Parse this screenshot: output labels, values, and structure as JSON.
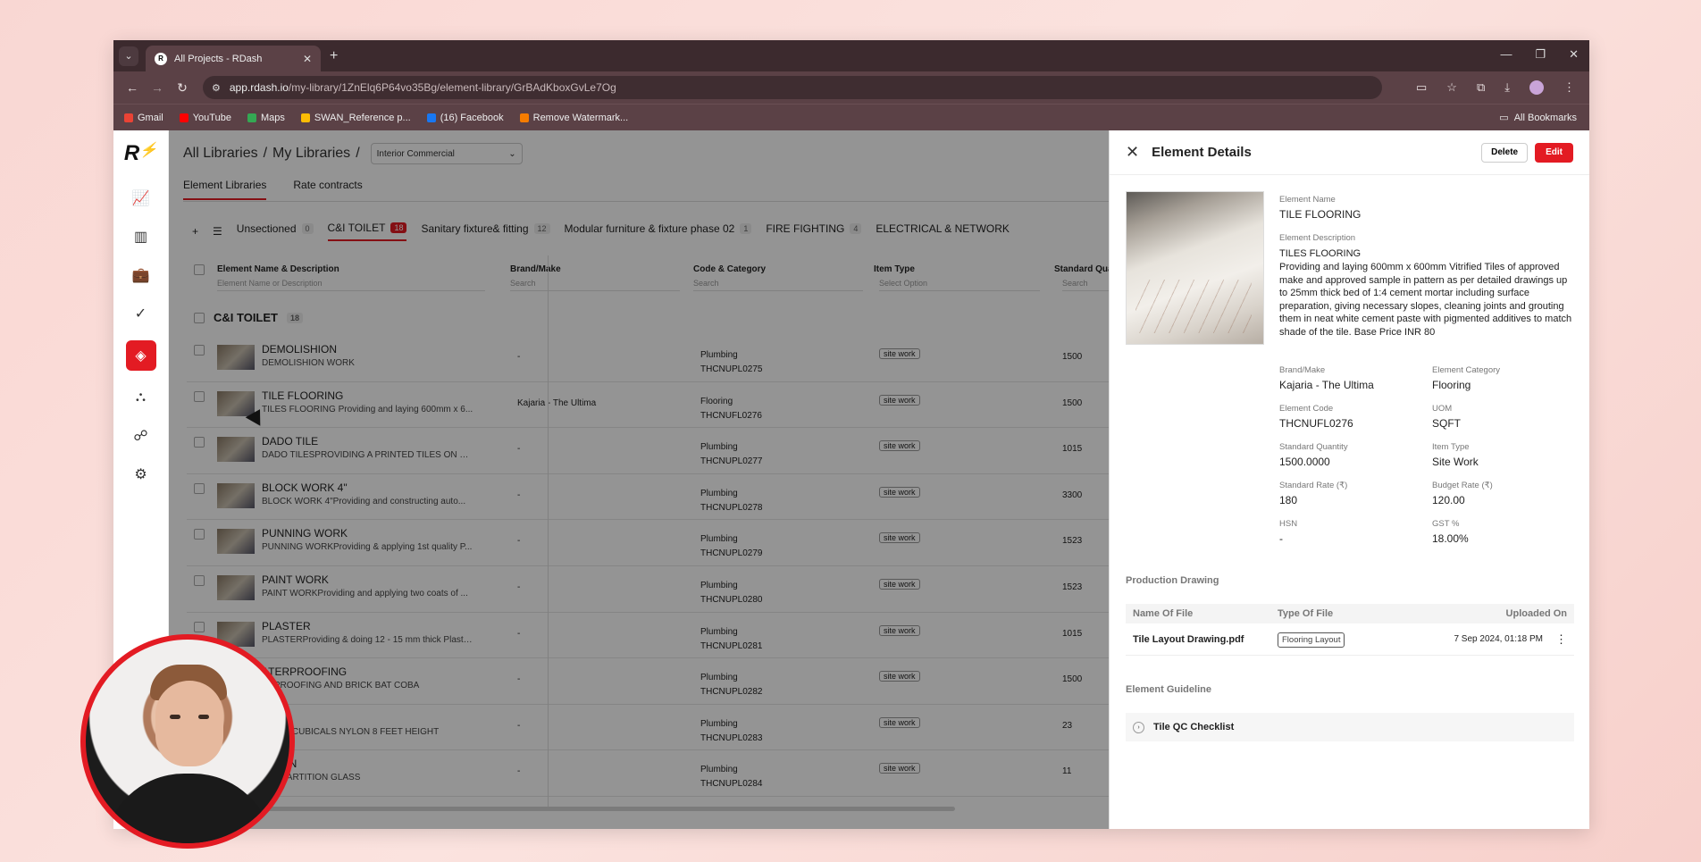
{
  "browser": {
    "tab_title": "All Projects - RDash",
    "url_domain": "app.rdash.io",
    "url_path": "/my-library/1ZnElq6P64vo35Bg/element-library/GrBAdKboxGvLe7Og",
    "bookmarks": [
      "Gmail",
      "YouTube",
      "Maps",
      "SWAN_Reference p...",
      "(16) Facebook",
      "Remove Watermark..."
    ],
    "all_bookmarks": "All Bookmarks"
  },
  "breadcrumb": {
    "all_libraries": "All Libraries",
    "sep1": "/",
    "my_libraries": "My Libraries",
    "sep2": "/",
    "library_select": "Interior Commercial"
  },
  "subtabs": [
    "Element Libraries",
    "Rate contracts"
  ],
  "category_tabs": [
    {
      "label": "Unsectioned",
      "count": "0"
    },
    {
      "label": "C&I TOILET",
      "count": "18"
    },
    {
      "label": "Sanitary fixture& fitting",
      "count": "12"
    },
    {
      "label": "Modular furniture & fixture phase 02",
      "count": "1"
    },
    {
      "label": "FIRE FIGHTING",
      "count": "4"
    },
    {
      "label": "ELECTRICAL & NETWORK",
      "count": ""
    }
  ],
  "table": {
    "headers": {
      "name": "Element Name & Description",
      "brand": "Brand/Make",
      "code": "Code & Category",
      "item_type": "Item Type",
      "qty": "Standard Quant"
    },
    "search_placeholders": {
      "name": "Element Name or Description",
      "brand": "Search",
      "code": "Search",
      "item_type": "Select Option",
      "qty": "Search"
    },
    "group": {
      "label": "C&I TOILET",
      "count": "18"
    },
    "rows": [
      {
        "name": "DEMOLISHION",
        "desc": "DEMOLISHION WORK",
        "brand": "-",
        "category": "Plumbing",
        "code": "THCNUPL0275",
        "type": "site work",
        "qty": "1500"
      },
      {
        "name": "TILE FLOORING",
        "desc": "TILES FLOORING Providing and laying 600mm x 6...",
        "brand": "Kajaria - The Ultima",
        "category": "Flooring",
        "code": "THCNUFL0276",
        "type": "site work",
        "qty": "1500"
      },
      {
        "name": "DADO TILE",
        "desc": "DADO TILESPROVIDING A PRINTED TILES ON WAL...",
        "brand": "-",
        "category": "Plumbing",
        "code": "THCNUPL0277",
        "type": "site work",
        "qty": "1015"
      },
      {
        "name": "BLOCK WORK 4\"",
        "desc": "BLOCK WORK 4\"Providing and constructing auto...",
        "brand": "-",
        "category": "Plumbing",
        "code": "THCNUPL0278",
        "type": "site work",
        "qty": "3300"
      },
      {
        "name": "PUNNING WORK",
        "desc": "PUNNING WORKProviding & applying 1st quality P...",
        "brand": "-",
        "category": "Plumbing",
        "code": "THCNUPL0279",
        "type": "site work",
        "qty": "1523"
      },
      {
        "name": "PAINT WORK",
        "desc": "PAINT WORKProviding and applying two coats of ...",
        "brand": "-",
        "category": "Plumbing",
        "code": "THCNUPL0280",
        "type": "site work",
        "qty": "1523"
      },
      {
        "name": "PLASTER",
        "desc": "PLASTERProviding & doing 12 - 15 mm thick Plaster...",
        "brand": "-",
        "category": "Plumbing",
        "code": "THCNUPL0281",
        "type": "site work",
        "qty": "1015"
      },
      {
        "name": "ATERPROOFING",
        "desc": "ERPROOFING AND BRICK BAT COBA",
        "brand": "-",
        "category": "Plumbing",
        "code": "THCNUPL0282",
        "type": "site work",
        "qty": "1500"
      },
      {
        "name": "CLE",
        "desc": "ROOM CUBICALS NYLON 8 FEET HEIGHT",
        "brand": "-",
        "category": "Plumbing",
        "code": "THCNUPL0283",
        "type": "site work",
        "qty": "23"
      },
      {
        "name": "TITION",
        "desc": "NAL PARTITION GLASS",
        "brand": "-",
        "category": "Plumbing",
        "code": "THCNUPL0284",
        "type": "site work",
        "qty": "11"
      }
    ]
  },
  "panel": {
    "title": "Element Details",
    "delete_label": "Delete",
    "edit_label": "Edit",
    "element_name_label": "Element Name",
    "element_name": "TILE FLOORING",
    "element_desc_label": "Element Description",
    "element_desc_title": "TILES FLOORING",
    "element_desc": "Providing and laying 600mm x 600mm Vitrified Tiles of approved make and approved sample in pattern as per detailed drawings up to 25mm thick bed of 1:4 cement mortar including surface preparation, giving necessary slopes, cleaning joints and grouting them in neat white cement paste with pigmented additives to match shade of the tile. Base Price INR 80",
    "brand_label": "Brand/Make",
    "brand": "Kajaria - The Ultima",
    "category_label": "Element Category",
    "category": "Flooring",
    "code_label": "Element Code",
    "code": "THCNUFL0276",
    "uom_label": "UOM",
    "uom": "SQFT",
    "std_qty_label": "Standard Quantity",
    "std_qty": "1500.0000",
    "item_type_label": "Item Type",
    "item_type": "Site Work",
    "std_rate_label": "Standard Rate (₹)",
    "std_rate": "180",
    "budget_rate_label": "Budget Rate (₹)",
    "budget_rate": "120.00",
    "hsn_label": "HSN",
    "hsn": "-",
    "gst_label": "GST %",
    "gst": "18.00%",
    "production_drawing_title": "Production Drawing",
    "drawing_headers": {
      "name": "Name Of File",
      "type": "Type Of File",
      "uploaded": "Uploaded On"
    },
    "drawing_row": {
      "name": "Tile Layout Drawing.pdf",
      "type": "Flooring Layout",
      "uploaded": "7 Sep 2024, 01:18 PM"
    },
    "guideline_title": "Element Guideline",
    "guideline_item": "Tile QC Checklist"
  },
  "colors": {
    "accent": "#e31b23"
  }
}
